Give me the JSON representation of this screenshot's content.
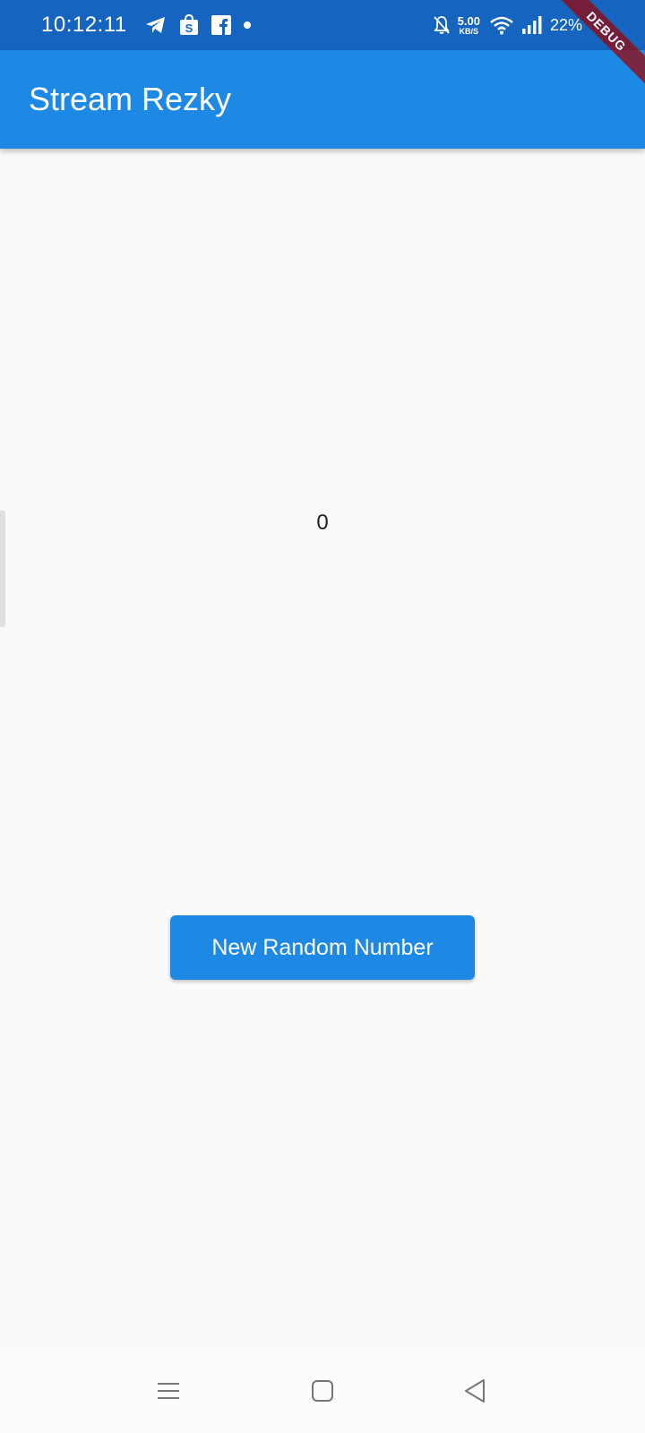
{
  "status_bar": {
    "time": "10:12:11",
    "net_speed": "5.00",
    "net_unit": "KB/S",
    "battery": "22%",
    "icons": [
      "telegram-icon",
      "shopee-bag-icon",
      "facebook-icon",
      "notification-dot-icon",
      "mute-bell-icon",
      "wifi-icon",
      "signal-icon"
    ]
  },
  "debug_banner": "DEBUG",
  "app_bar": {
    "title": "Stream Rezky"
  },
  "main": {
    "number": "0",
    "button_label": "New Random Number"
  },
  "nav_bar": {
    "buttons": [
      "recent-apps-icon",
      "home-icon",
      "back-icon"
    ]
  },
  "colors": {
    "status_bar": "#1565c0",
    "app_bar": "#1e88e5",
    "background": "#fafafa",
    "button": "#1e88e5",
    "debug_banner": "#a00000"
  }
}
